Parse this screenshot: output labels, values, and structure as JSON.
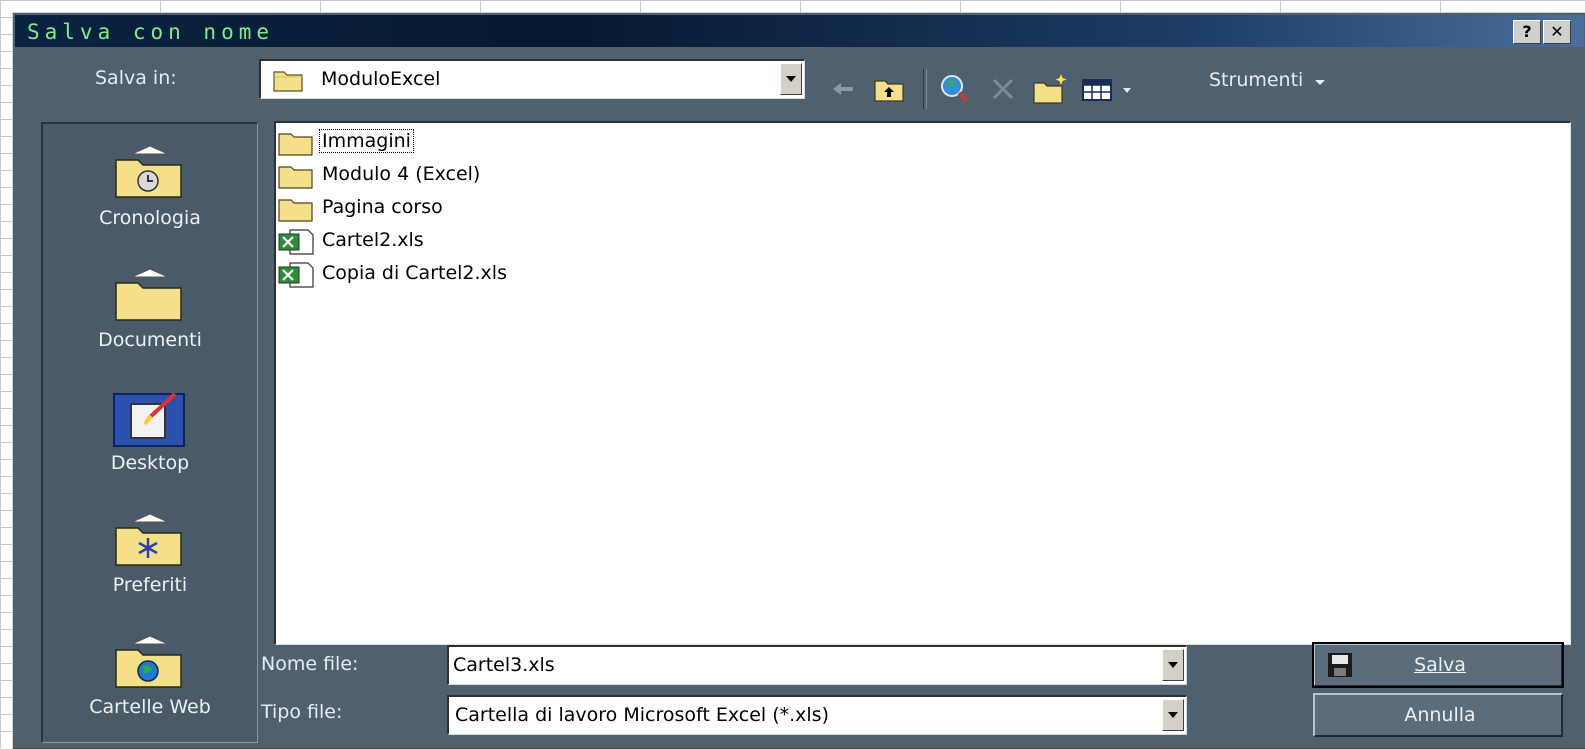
{
  "window": {
    "title": "Salva con nome",
    "help_button": "?",
    "close_button": "✕"
  },
  "toolbar": {
    "save_in_label": "Salva in:",
    "current_folder": "ModuloExcel",
    "tools_label": "Strumenti"
  },
  "places": [
    {
      "label": "Cronologia",
      "icon": "history-folder-icon"
    },
    {
      "label": "Documenti",
      "icon": "my-documents-folder-icon"
    },
    {
      "label": "Desktop",
      "icon": "desktop-icon"
    },
    {
      "label": "Preferiti",
      "icon": "favorites-folder-icon"
    },
    {
      "label": "Cartelle Web",
      "icon": "web-folders-icon"
    }
  ],
  "files": [
    {
      "name": "Immagini",
      "type": "folder"
    },
    {
      "name": "Modulo 4 (Excel)",
      "type": "folder"
    },
    {
      "name": "Pagina corso",
      "type": "folder"
    },
    {
      "name": "Cartel2.xls",
      "type": "excel"
    },
    {
      "name": "Copia di Cartel2.xls",
      "type": "excel"
    }
  ],
  "form": {
    "filename_label": "Nome file:",
    "filename_value": "Cartel3.xls",
    "filetype_label": "Tipo file:",
    "filetype_value": "Cartella di lavoro Microsoft Excel (*.xls)"
  },
  "buttons": {
    "save": "Salva",
    "cancel": "Annulla"
  },
  "colors": {
    "title_text": "#7aef8c",
    "dialog_bg": "#4f606f",
    "folder_yellow": "#f5e08a"
  }
}
